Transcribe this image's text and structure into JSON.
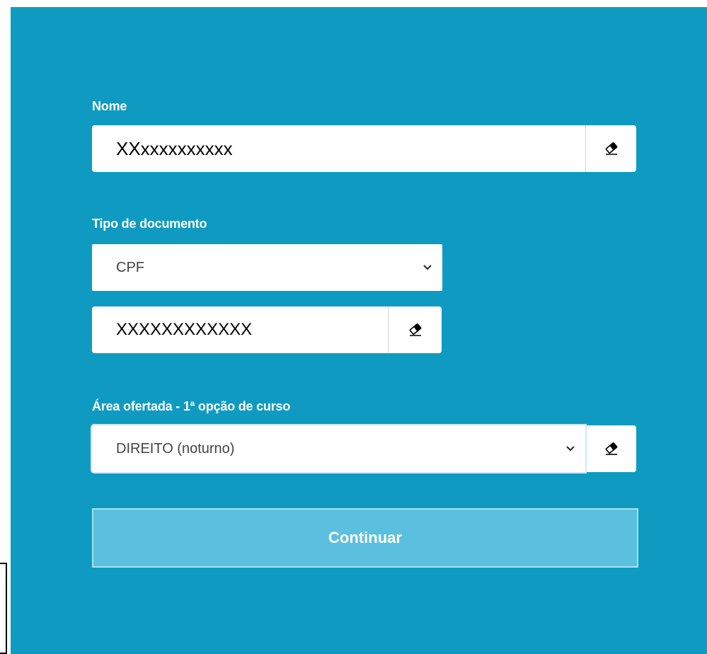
{
  "form": {
    "nome": {
      "label": "Nome",
      "value": "XXxxxxxxxxxx",
      "clear_icon": "eraser-icon"
    },
    "tipo_documento": {
      "label": "Tipo de documento",
      "selected": "CPF",
      "number_value": "XXXXXXXXXXXX",
      "clear_icon": "eraser-icon"
    },
    "area_ofertada": {
      "label": "Área ofertada - 1ª opção de curso",
      "selected": "DIREITO (noturno)",
      "clear_icon": "eraser-icon"
    },
    "continue_label": "Continuar"
  },
  "colors": {
    "panel_bg": "#0f9bc1",
    "button_bg": "#5bc0df",
    "label_text": "#ffffff"
  }
}
